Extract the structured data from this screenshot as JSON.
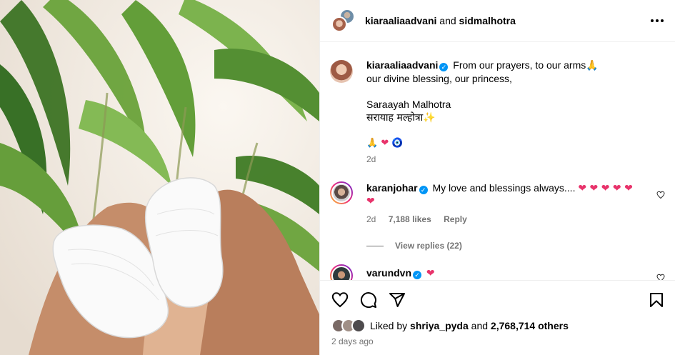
{
  "header": {
    "user1": "kiaraaliaadvani",
    "joiner": "and",
    "user2": "sidmalhotra"
  },
  "caption": {
    "username": "kiaraaliaadvani",
    "line1": "From our prayers, to our arms",
    "line1_emoji": "🙏",
    "line2": "our divine blessing, our princess,",
    "line3": "Saraayah Malhotra",
    "line4": "सरायाह मल्होत्रा",
    "line4_emoji": "✨",
    "emojis": [
      "🙏",
      "❤",
      "🧿"
    ],
    "time": "2d"
  },
  "comments": [
    {
      "username": "karanjohar",
      "text": "My love and blessings always....",
      "hearts": "❤ ❤ ❤ ❤ ❤",
      "hearts_line2": "❤",
      "time": "2d",
      "likes": "7,188 likes",
      "reply_label": "Reply",
      "view_replies": "View replies (22)"
    },
    {
      "username": "varundvn",
      "hearts": "❤"
    }
  ],
  "actions": {
    "liked_prefix": "Liked by",
    "liked_user": "shriya_pyda",
    "liked_and": "and",
    "liked_others": "2,768,714 others",
    "time_ago": "2 days ago"
  },
  "icons": [
    "more-icon",
    "verified-icon",
    "heart-icon",
    "comment-icon",
    "share-icon",
    "bookmark-icon"
  ],
  "colors": {
    "verified": "#0095f6",
    "heart": "#e8336b",
    "muted": "#737373"
  }
}
